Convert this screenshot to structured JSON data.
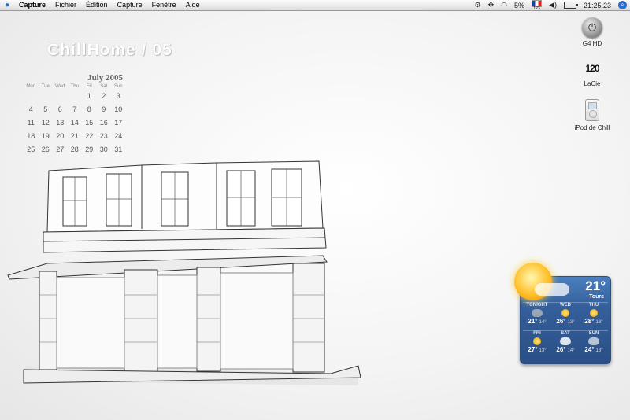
{
  "menubar": {
    "items": [
      "Capture",
      "Fichier",
      "Édition",
      "Capture",
      "Fenêtre",
      "Aide"
    ],
    "battery_percent": "5%",
    "input_code": "123",
    "clock": "21:25:23"
  },
  "desktop": {
    "brand": "ChillHome / 05",
    "calendar": {
      "title": "July 2005",
      "weekdays": [
        "Mon",
        "Tue",
        "Wed",
        "Thu",
        "Fri",
        "Sat",
        "Sun"
      ],
      "days": [
        "",
        "",
        "",
        "",
        "1",
        "2",
        "3",
        "4",
        "5",
        "6",
        "7",
        "8",
        "9",
        "10",
        "11",
        "12",
        "13",
        "14",
        "15",
        "16",
        "17",
        "18",
        "19",
        "20",
        "21",
        "22",
        "23",
        "24",
        "25",
        "26",
        "27",
        "28",
        "29",
        "30",
        "31"
      ]
    },
    "icons": [
      {
        "label": "G4 HD",
        "icon": "hard-drive-icon"
      },
      {
        "label": "LaCie",
        "icon": "lacie-drive-icon"
      },
      {
        "label": "iPod de Chill",
        "icon": "ipod-icon"
      }
    ]
  },
  "weather": {
    "temperature": "21°",
    "city": "Tours",
    "row1": [
      {
        "day": "TONIGHT",
        "icon": "partly-cloudy-night",
        "hi": "21°",
        "lo": "14°"
      },
      {
        "day": "WED",
        "icon": "sunny",
        "hi": "26°",
        "lo": "13°"
      },
      {
        "day": "THU",
        "icon": "sunny",
        "hi": "28°",
        "lo": "13°"
      }
    ],
    "row2": [
      {
        "day": "FRI",
        "icon": "sunny",
        "hi": "27°",
        "lo": "13°"
      },
      {
        "day": "SAT",
        "icon": "cloudy",
        "hi": "26°",
        "lo": "14°"
      },
      {
        "day": "SUN",
        "icon": "showers",
        "hi": "24°",
        "lo": "13°"
      }
    ]
  }
}
